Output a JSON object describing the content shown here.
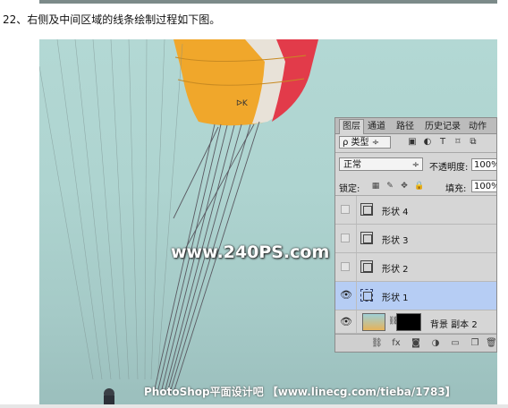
{
  "caption": "22、右侧及中间区域的线条绘制过程如下图。",
  "watermark_main": "www.240PS.com",
  "watermark_bottom": "PhotoShop平面设计吧 【www.linecg.com/tieba/1783】",
  "panel": {
    "tabs": [
      "图层",
      "通道",
      "路径",
      "历史记录",
      "动作"
    ],
    "active_tab": 0,
    "filter_kind": "ρ 类型",
    "blend_mode": "正常",
    "opacity_label": "不透明度:",
    "opacity_value": "100%",
    "lock_label": "锁定:",
    "fill_label": "填充:",
    "fill_value": "100%",
    "layers": [
      {
        "name": "形状 4",
        "visible": false,
        "selected": false
      },
      {
        "name": "形状 3",
        "visible": false,
        "selected": false
      },
      {
        "name": "形状 2",
        "visible": false,
        "selected": false
      },
      {
        "name": "形状 1",
        "visible": true,
        "selected": true
      }
    ],
    "background_layer": {
      "name": "背景 副本 2",
      "visible": true
    }
  }
}
